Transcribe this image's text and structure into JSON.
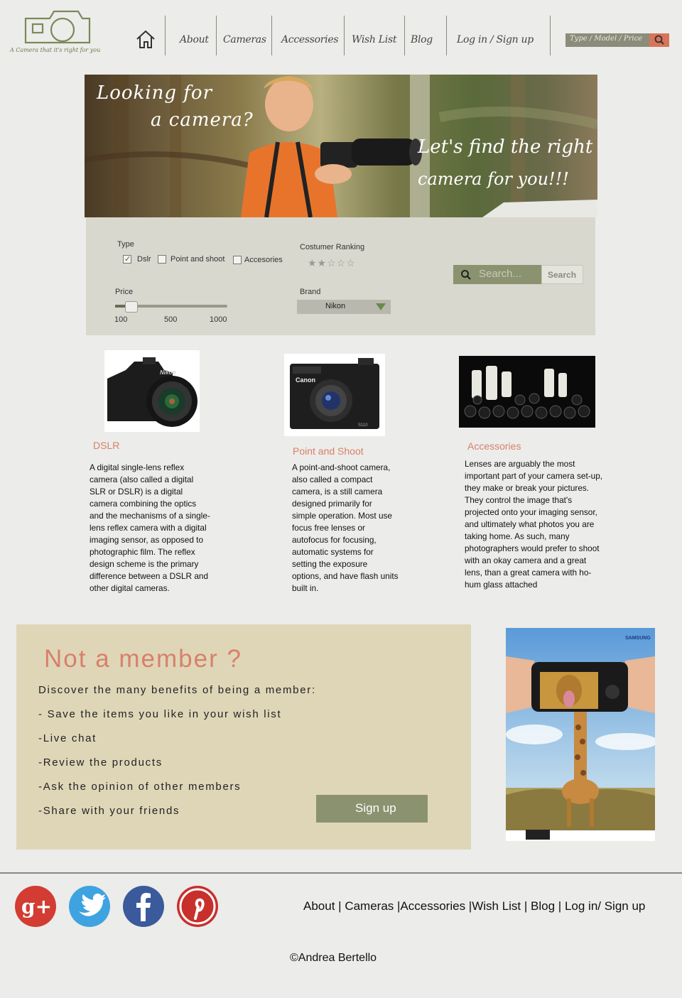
{
  "header": {
    "logo_tagline": "A Camera that it's right for you",
    "nav": [
      "About",
      "Cameras",
      "Accessories",
      "Wish List",
      "Blog"
    ],
    "login": "Log in / Sign up",
    "search_placeholder": "Type / Model / Price"
  },
  "hero": {
    "title_line1": "Looking for",
    "title_line2": "a camera?",
    "sub_line1": "Let's find the right",
    "sub_line2": "camera for you!!!"
  },
  "filters": {
    "type_label": "Type",
    "type_options": [
      {
        "label": "Dslr",
        "checked": true
      },
      {
        "label": "Point and shoot",
        "checked": false
      },
      {
        "label": "Accesories",
        "checked": false
      }
    ],
    "ranking_label": "Costumer Ranking",
    "ranking_stars": "★★☆☆☆",
    "ranking_value": 1.5,
    "ranking_max": 5,
    "price_label": "Price",
    "price_ticks": [
      "100",
      "500",
      "1000"
    ],
    "price_value_fraction": 0.1,
    "brand_label": "Brand",
    "brand_value": "Nikon",
    "search_placeholder": "Search...",
    "search_button": "Search"
  },
  "categories": [
    {
      "title": "DSLR",
      "text": "A digital single-lens reflex camera (also called a digital SLR or DSLR) is a digital camera combining the optics and the mechanisms of a single-lens reflex camera with a digital imaging sensor, as opposed to photographic film. The reflex design scheme is the primary difference between a DSLR and other digital cameras."
    },
    {
      "title": "Point and Shoot",
      "text": "A point-and-shoot camera, also called a compact camera, is a still camera designed primarily for simple operation. Most use focus free lenses or autofocus for focusing, automatic systems for setting the exposure options, and have flash units built in."
    },
    {
      "title": "Accessories",
      "text": "Lenses are arguably the most important part of your camera set-up, they make or break your pictures. They control the image that's projected onto your imaging sensor, and ultimately what photos you are taking home. As such, many photographers would prefer to shoot with an okay camera and a great lens, than a great camera with ho-hum glass attached"
    }
  ],
  "member": {
    "title": "Not  a member ?",
    "lines": [
      "Discover the many benefits of being a member:",
      "- Save the items you like in your wish list",
      "-Live chat",
      "-Review the products",
      "-Ask the opinion of other members",
      "-Share with your friends"
    ],
    "signup": "Sign up"
  },
  "ad": {
    "brand": "SAMSUNG"
  },
  "footer": {
    "social": [
      "google-plus",
      "twitter",
      "facebook",
      "pinterest"
    ],
    "links": [
      "About",
      "Cameras",
      "Accessories",
      "Wish List",
      "Blog",
      "Log in/ Sign up"
    ],
    "copyright": "©Andrea Bertello"
  },
  "colors": {
    "accent": "#d8806a",
    "olive": "#8b9270",
    "member_bg": "#dfd6b8",
    "search_btn": "#d8745a"
  }
}
